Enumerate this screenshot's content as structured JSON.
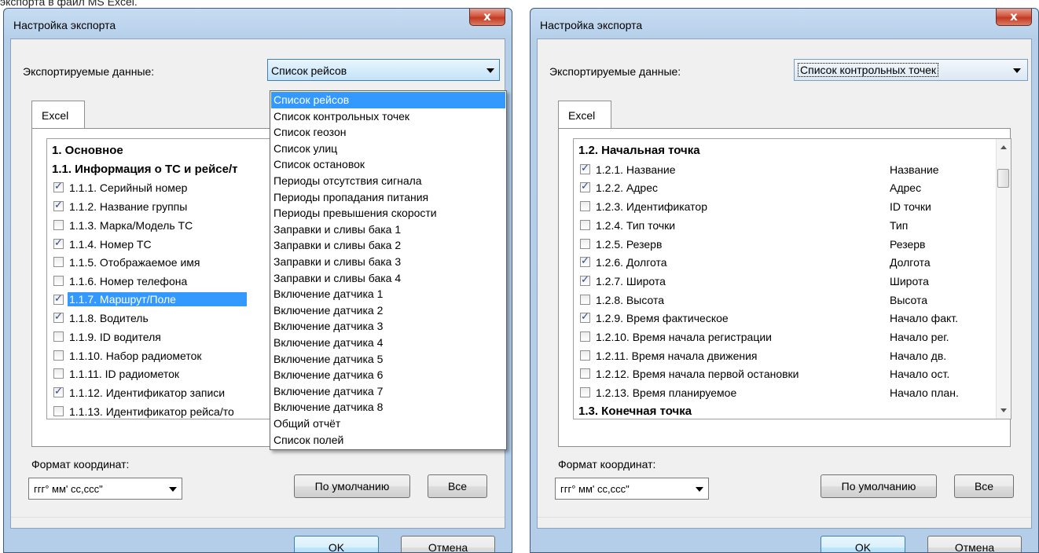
{
  "caption": "экспорта в файл MS Excel.",
  "left": {
    "title": "Настройка экспорта",
    "close": "x",
    "data_label": "Экспортируемые данные:",
    "combo_value": "Список рейсов",
    "tab": "Excel",
    "list": [
      {
        "text": "1. Основное",
        "header": true
      },
      {
        "text": "1.1. Информация о ТС и рейсе/т",
        "header": true
      },
      {
        "text": "1.1.1. Серийный номер",
        "checked": true
      },
      {
        "text": "1.1.2. Название группы",
        "checked": true
      },
      {
        "text": "1.1.3. Марка/Модель ТС",
        "checked": false
      },
      {
        "text": "1.1.4. Номер ТС",
        "checked": true
      },
      {
        "text": "1.1.5. Отображаемое имя",
        "checked": false
      },
      {
        "text": "1.1.6. Номер телефона",
        "checked": false
      },
      {
        "text": "1.1.7. Маршрут/Поле",
        "checked": true,
        "selected": true
      },
      {
        "text": "1.1.8. Водитель",
        "checked": true
      },
      {
        "text": "1.1.9. ID водителя",
        "checked": false
      },
      {
        "text": "1.1.10. Набор радиометок",
        "checked": false
      },
      {
        "text": "1.1.11. ID радиометок",
        "checked": false
      },
      {
        "text": "1.1.12. Идентификатор записи",
        "checked": true
      },
      {
        "text": "1.1.13. Идентификатор рейса/то",
        "checked": false
      }
    ],
    "dropdown": [
      "Список рейсов",
      "Список контрольных точек",
      "Список геозон",
      "Список улиц",
      "Список остановок",
      "Периоды отсутствия сигнала",
      "Периоды пропадания питания",
      "Периоды превышения скорости",
      "Заправки и сливы бака 1",
      "Заправки и сливы бака 2",
      "Заправки и сливы бака 3",
      "Заправки и сливы бака 4",
      "Включение датчика 1",
      "Включение датчика 2",
      "Включение датчика 3",
      "Включение датчика 4",
      "Включение датчика 5",
      "Включение датчика 6",
      "Включение датчика 7",
      "Включение датчика 8",
      "Общий отчёт",
      "Список полей"
    ],
    "coord_label": "Формат координат:",
    "coord_value": "ггг° мм' сс,ссс\"",
    "default_btn": "По умолчанию",
    "all_btn": "Все",
    "ok_btn": "OK",
    "cancel_btn": "Отмена"
  },
  "right": {
    "title": "Настройка экспорта",
    "close": "x",
    "data_label": "Экспортируемые данные:",
    "combo_value": "Список контрольных точек",
    "tab": "Excel",
    "list": [
      {
        "text": "1.2. Начальная точка",
        "header": true
      },
      {
        "text": "1.2.1. Название",
        "col2": "Название",
        "checked": true
      },
      {
        "text": "1.2.2. Адрес",
        "col2": "Адрес",
        "checked": true
      },
      {
        "text": "1.2.3. Идентификатор",
        "col2": "ID точки",
        "checked": false
      },
      {
        "text": "1.2.4. Тип точки",
        "col2": "Тип",
        "checked": false
      },
      {
        "text": "1.2.5. Резерв",
        "col2": "Резерв",
        "checked": false
      },
      {
        "text": "1.2.6. Долгота",
        "col2": "Долгота",
        "checked": true
      },
      {
        "text": "1.2.7. Широта",
        "col2": "Широта",
        "checked": true
      },
      {
        "text": "1.2.8. Высота",
        "col2": "Высота",
        "checked": false
      },
      {
        "text": "1.2.9. Время фактическое",
        "col2": "Начало факт.",
        "checked": true
      },
      {
        "text": "1.2.10. Время начала регистрации",
        "col2": "Начало рег.",
        "checked": false
      },
      {
        "text": "1.2.11. Время начала движения",
        "col2": "Начало дв.",
        "checked": false
      },
      {
        "text": "1.2.12. Время начала первой остановки",
        "col2": "Начало ост.",
        "checked": false
      },
      {
        "text": "1.2.13. Время планируемое",
        "col2": "Начало план.",
        "checked": false
      },
      {
        "text": "1.3. Конечная точка",
        "header": true
      }
    ],
    "coord_label": "Формат координат:",
    "coord_value": "ггг° мм' сс,ссс\"",
    "default_btn": "По умолчанию",
    "all_btn": "Все",
    "ok_btn": "OK",
    "cancel_btn": "Отмена"
  }
}
